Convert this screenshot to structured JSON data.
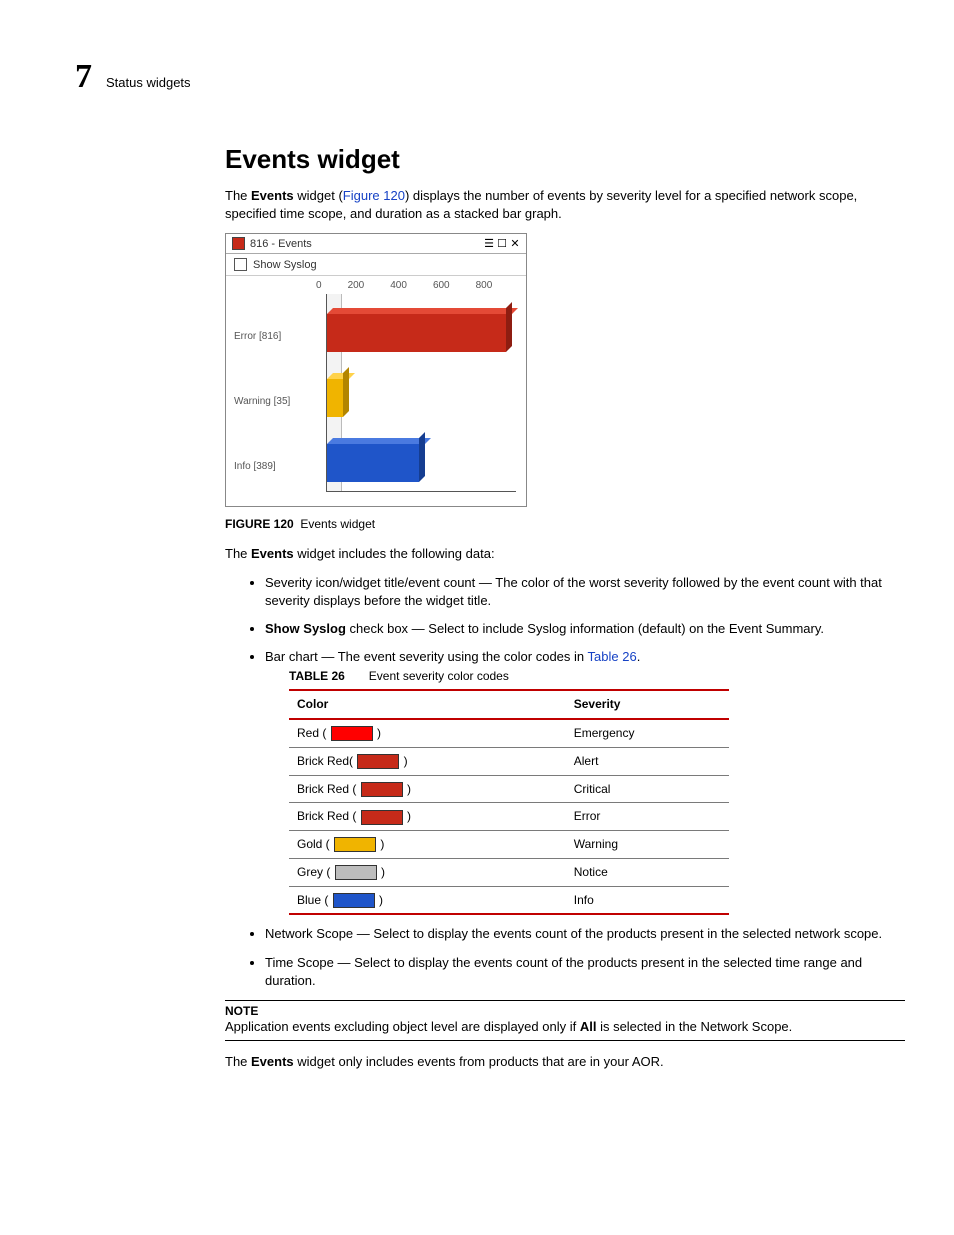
{
  "chapter": {
    "number": "7",
    "title": "Status widgets"
  },
  "heading": "Events widget",
  "intro": {
    "pre": "The ",
    "bold": "Events",
    "mid": " widget (",
    "link": "Figure 120",
    "post": ") displays the number of events by severity level for a specified network scope, specified time scope, and duration as a stacked bar graph."
  },
  "widget": {
    "title": "816 - Events",
    "show_syslog_label": "Show Syslog",
    "icons": {
      "collapse": "☰",
      "maximize": "☐",
      "close": "✕"
    }
  },
  "chart_data": {
    "type": "bar",
    "orientation": "horizontal",
    "categories": [
      "Error [816]",
      "Warning [35]",
      "Info [389]"
    ],
    "values": [
      816,
      35,
      389
    ],
    "xlim": [
      0,
      800
    ],
    "xticks": [
      "0",
      "200",
      "400",
      "600",
      "800"
    ],
    "colors": [
      "#c62a19",
      "#f0b400",
      "#1f55c9"
    ],
    "title": "",
    "xlabel": "",
    "ylabel": ""
  },
  "figure_caption": {
    "label": "FIGURE 120",
    "title": "Events widget"
  },
  "intro2": {
    "pre": "The ",
    "bold": "Events",
    "post": " widget includes the following data:"
  },
  "bullets_top": [
    {
      "text_pre": "Severity icon/widget title/event count — The color of the worst severity followed by the event count with that severity displays before the widget title."
    },
    {
      "bold": "Show Syslog",
      "text_post": " check box — Select to include Syslog information (default) on the Event Summary."
    },
    {
      "text_pre": "Bar chart — The event severity using the color codes in ",
      "link": "Table 26",
      "text_post": "."
    }
  ],
  "table_caption": {
    "label": "TABLE 26",
    "title": "Event severity color codes"
  },
  "table": {
    "headers": [
      "Color",
      "Severity"
    ],
    "rows": [
      {
        "label_pre": "Red ( ",
        "swatch": "#ff0000",
        "label_post": " )",
        "severity": "Emergency"
      },
      {
        "label_pre": "Brick Red( ",
        "swatch": "#c62a19",
        "label_post": " )",
        "severity": "Alert"
      },
      {
        "label_pre": "Brick Red ( ",
        "swatch": "#c62a19",
        "label_post": " )",
        "severity": "Critical"
      },
      {
        "label_pre": "Brick Red ( ",
        "swatch": "#c62a19",
        "label_post": " )",
        "severity": "Error"
      },
      {
        "label_pre": "Gold ( ",
        "swatch": "#f0b400",
        "label_post": " )",
        "severity": "Warning"
      },
      {
        "label_pre": "Grey ( ",
        "swatch": "#bdbdbd",
        "label_post": " )",
        "severity": "Notice"
      },
      {
        "label_pre": "Blue ( ",
        "swatch": "#1f55c9",
        "label_post": " )",
        "severity": "Info"
      }
    ]
  },
  "bullets_bottom": [
    "Network Scope — Select to display the events count of the products present in the selected network scope.",
    "Time Scope — Select to display the events count of the products present in the selected time range and duration."
  ],
  "note": {
    "label": "NOTE",
    "text_pre": "Application events excluding object level are displayed only if ",
    "bold": "All",
    "text_post": " is selected in the Network Scope."
  },
  "outro": {
    "pre": "The ",
    "bold": "Events",
    "post": " widget only includes events from products that are in your AOR."
  }
}
